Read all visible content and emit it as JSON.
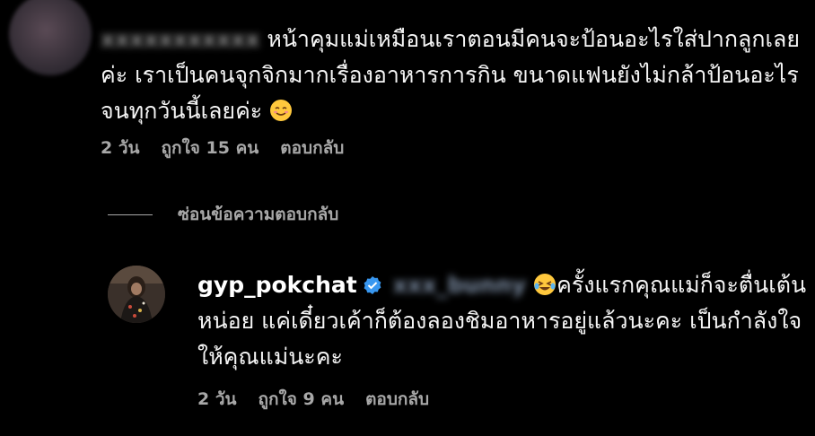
{
  "comment": {
    "text": "หน้าคุมแม่เหมือนเราตอนมีคนจะป้อนอะไรใส่ปากลูกเลย ค่ะ เราเป็นคนจุกจิกมากเรื่องอาหารการกิน ขนาดแฟนยังไม่กล้าป้อนอะไรจนทุกวันนี้เลยค่ะ",
    "emoji": "smiling-face-emoji",
    "time": "2 วัน",
    "likes": "ถูกใจ 15 คน",
    "reply_label": "ตอบกลับ"
  },
  "hide_replies_label": "ซ่อนข้อความตอบกลับ",
  "reply": {
    "username": "gyp_pokchat",
    "text": "ครั้งแรกคุณแม่ก็จะตื่นเต้นหน่อย แค่เดี๋ยวเค้าก็ต้องลองชิมอาหารอยู่แล้วนะคะ เป็นกำลังใจให้คุณแม่นะคะ",
    "emoji": "laughing-tears-emoji",
    "time": "2 วัน",
    "likes": "ถูกใจ 9 คน",
    "reply_label": "ตอบกลับ"
  },
  "colors": {
    "background": "#000000",
    "text": "#f5f5f5",
    "secondary": "#a8a8a8",
    "verified": "#3897f0"
  }
}
